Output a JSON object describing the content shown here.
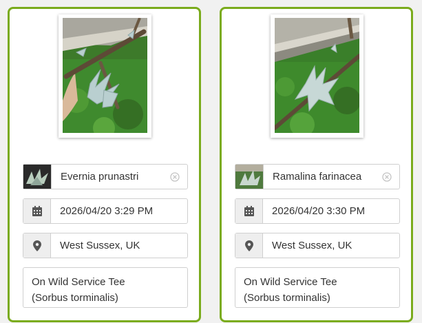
{
  "cards": [
    {
      "species": "Evernia prunastri",
      "datetime": "2026/04/20 3:29 PM",
      "location": "West Sussex, UK",
      "notes": "On Wild Service Tee\n(Sorbus torminalis)"
    },
    {
      "species": "Ramalina farinacea",
      "datetime": "2026/04/20 3:30 PM",
      "location": "West Sussex, UK",
      "notes": "On Wild Service Tee\n(Sorbus torminalis)"
    }
  ],
  "icons": {
    "date": "calendar-icon",
    "location": "map-marker-icon",
    "clear": "clear-circle-x-icon"
  },
  "colors": {
    "card_border": "#7aab1c",
    "field_border": "#cfcfcf",
    "addon_bg": "#eeeeee",
    "icon": "#555555"
  }
}
